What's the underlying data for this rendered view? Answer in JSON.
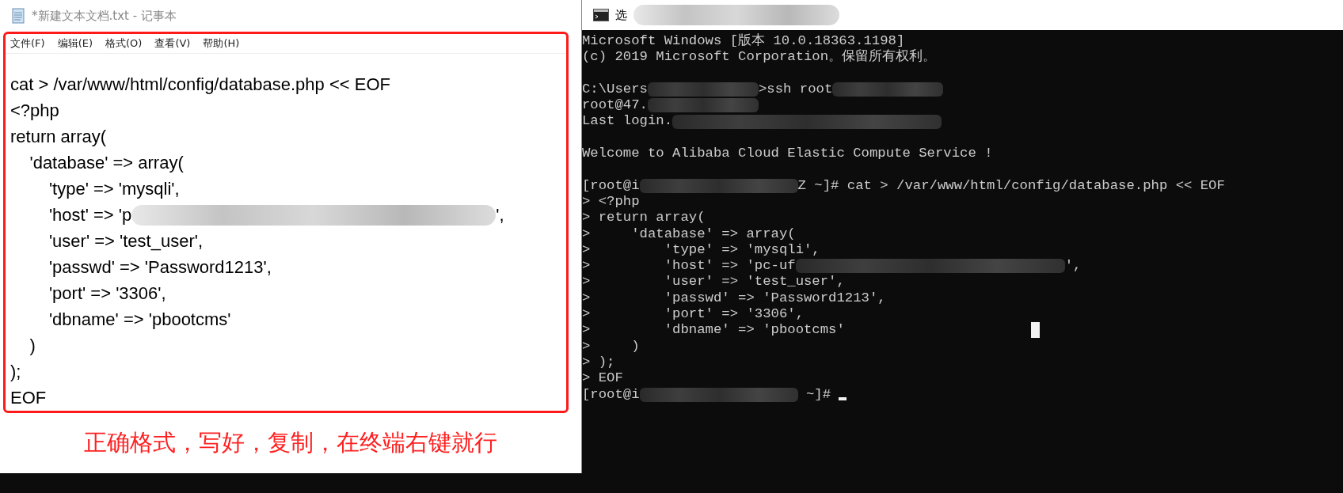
{
  "notepad": {
    "title": "*新建文本文档.txt - 记事本",
    "menu": [
      "文件(F)",
      "编辑(E)",
      "格式(O)",
      "查看(V)",
      "帮助(H)"
    ],
    "lines": [
      {
        "kind": "text",
        "segments": [
          {
            "kind": "text",
            "text": "cat > /var/www/html/config/database.php << EOF"
          }
        ]
      },
      {
        "kind": "text",
        "segments": [
          {
            "kind": "text",
            "text": "<?php"
          }
        ]
      },
      {
        "kind": "text",
        "segments": [
          {
            "kind": "text",
            "text": "return array("
          }
        ]
      },
      {
        "kind": "text",
        "segments": [
          {
            "kind": "text",
            "text": "    'database' => array("
          }
        ]
      },
      {
        "kind": "text",
        "segments": [
          {
            "kind": "text",
            "text": "        'type' => 'mysqli',"
          }
        ]
      },
      {
        "kind": "text",
        "segments": [
          {
            "kind": "text",
            "text": "        'host' => 'p"
          },
          {
            "kind": "blur_long"
          },
          {
            "kind": "text",
            "text": "',"
          }
        ]
      },
      {
        "kind": "text",
        "segments": [
          {
            "kind": "text",
            "text": "        'user' => 'test_user',"
          }
        ]
      },
      {
        "kind": "text",
        "segments": [
          {
            "kind": "text",
            "text": "        'passwd' => 'Password1213',"
          }
        ]
      },
      {
        "kind": "text",
        "segments": [
          {
            "kind": "text",
            "text": "        'port' => '3306',"
          }
        ]
      },
      {
        "kind": "text",
        "segments": [
          {
            "kind": "text",
            "text": "        'dbname' => 'pbootcms'"
          }
        ]
      },
      {
        "kind": "text",
        "segments": [
          {
            "kind": "text",
            "text": "    )"
          }
        ]
      },
      {
        "kind": "text",
        "segments": [
          {
            "kind": "text",
            "text": ");"
          }
        ]
      },
      {
        "kind": "text",
        "segments": [
          {
            "kind": "text",
            "text": "EOF"
          }
        ]
      }
    ]
  },
  "annotation": "正确格式，写好，复制，在终端右键就行",
  "terminal": {
    "title": "选",
    "lines": [
      {
        "kind": "text",
        "segments": [
          {
            "kind": "text",
            "text": "Microsoft Windows [版本 10.0.18363.1198]"
          }
        ]
      },
      {
        "kind": "text",
        "segments": [
          {
            "kind": "text",
            "text": "(c) 2019 Microsoft Corporation。保留所有权利。"
          }
        ]
      },
      {
        "kind": "blank"
      },
      {
        "kind": "text",
        "segments": [
          {
            "kind": "text",
            "text": "C:\\Users"
          },
          {
            "kind": "blur_short"
          },
          {
            "kind": "text",
            "text": ">ssh root"
          },
          {
            "kind": "blur_short"
          }
        ]
      },
      {
        "kind": "text",
        "segments": [
          {
            "kind": "text",
            "text": "root@47."
          },
          {
            "kind": "blur_short"
          }
        ]
      },
      {
        "kind": "text",
        "segments": [
          {
            "kind": "text",
            "text": "Last login."
          },
          {
            "kind": "blur_long"
          }
        ]
      },
      {
        "kind": "blank"
      },
      {
        "kind": "text",
        "segments": [
          {
            "kind": "text",
            "text": "Welcome to Alibaba Cloud Elastic Compute Service !"
          }
        ]
      },
      {
        "kind": "blank"
      },
      {
        "kind": "text",
        "segments": [
          {
            "kind": "text",
            "text": "[root@i"
          },
          {
            "kind": "blur_medium"
          },
          {
            "kind": "text",
            "text": "Z ~]# cat > /var/www/html/config/database.php << EOF"
          }
        ]
      },
      {
        "kind": "text",
        "segments": [
          {
            "kind": "text",
            "text": "> <?php"
          }
        ]
      },
      {
        "kind": "text",
        "segments": [
          {
            "kind": "text",
            "text": "> return array("
          }
        ]
      },
      {
        "kind": "text",
        "segments": [
          {
            "kind": "text",
            "text": ">     'database' => array("
          }
        ]
      },
      {
        "kind": "text",
        "segments": [
          {
            "kind": "text",
            "text": ">         'type' => 'mysqli',"
          }
        ]
      },
      {
        "kind": "text",
        "segments": [
          {
            "kind": "text",
            "text": ">         'host' => 'pc-uf"
          },
          {
            "kind": "blur_long"
          },
          {
            "kind": "text",
            "text": "',"
          }
        ]
      },
      {
        "kind": "text",
        "segments": [
          {
            "kind": "text",
            "text": ">         'user' => 'test_user',"
          }
        ]
      },
      {
        "kind": "text",
        "segments": [
          {
            "kind": "text",
            "text": ">         'passwd' => 'Password1213',"
          }
        ]
      },
      {
        "kind": "text",
        "segments": [
          {
            "kind": "text",
            "text": ">         'port' => '3306',"
          }
        ]
      },
      {
        "kind": "text",
        "segments": [
          {
            "kind": "text",
            "text": ">         'dbname' => 'pbootcms'"
          },
          {
            "kind": "pointer"
          }
        ]
      },
      {
        "kind": "text",
        "segments": [
          {
            "kind": "text",
            "text": ">     )"
          }
        ]
      },
      {
        "kind": "text",
        "segments": [
          {
            "kind": "text",
            "text": "> );"
          }
        ]
      },
      {
        "kind": "text",
        "segments": [
          {
            "kind": "text",
            "text": "> EOF"
          }
        ]
      },
      {
        "kind": "text",
        "segments": [
          {
            "kind": "text",
            "text": "[root@i"
          },
          {
            "kind": "blur_medium"
          },
          {
            "kind": "text",
            "text": " ~]# "
          },
          {
            "kind": "caret"
          }
        ]
      }
    ]
  }
}
